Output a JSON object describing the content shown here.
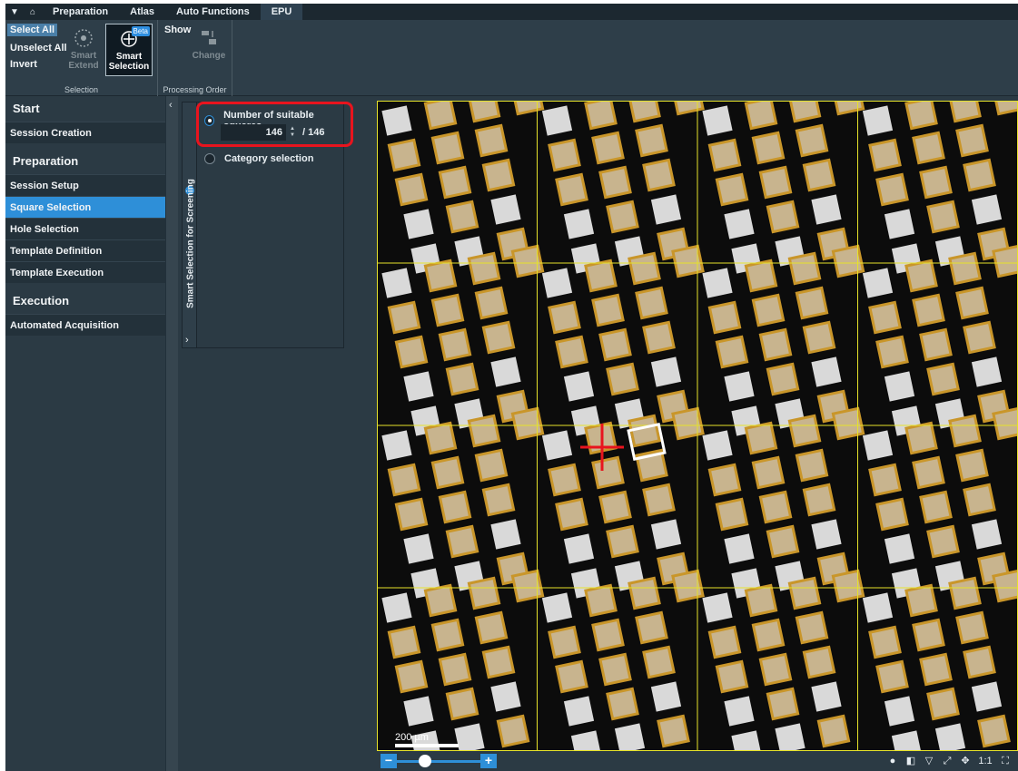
{
  "menubar": {
    "dropdown_icon": "caret-down-icon",
    "home_icon": "home-icon",
    "tabs": [
      {
        "label": "Preparation"
      },
      {
        "label": "Atlas"
      },
      {
        "label": "Auto Functions"
      },
      {
        "label": "EPU"
      }
    ],
    "active_tab": "EPU"
  },
  "ribbon": {
    "selection_group": {
      "label": "Selection",
      "select_all": "Select All",
      "unselect_all": "Unselect All",
      "invert": "Invert",
      "smart_extend": "Smart Extend",
      "smart_selection": "Smart Selection",
      "beta": "Beta"
    },
    "processing_group": {
      "label": "Processing Order",
      "show": "Show",
      "change": "Change"
    }
  },
  "workflow": {
    "sections": [
      {
        "header": "Start",
        "items": [
          "Session Creation"
        ]
      },
      {
        "header": "Preparation",
        "items": [
          "Session Setup",
          "Square Selection",
          "Hole Selection",
          "Template Definition",
          "Template Execution"
        ]
      },
      {
        "header": "Execution",
        "items": [
          "Automated Acquisition"
        ]
      }
    ],
    "active_item": "Square Selection"
  },
  "smart_panel": {
    "tab_label": "Smart Selection for Screening",
    "option_count": "Number of suitable squares",
    "count_value": "146",
    "count_total": "/ 146",
    "option_category": "Category selection"
  },
  "viewer": {
    "scale_label": "200 µm",
    "colors": {
      "selected_square": "#c9962a",
      "grid_line": "#e6e22a",
      "crosshair": "#e8141e"
    }
  },
  "toolbar": {
    "zoom_minus": "−",
    "zoom_plus": "+",
    "zoom_level": 0.4,
    "one_to_one": "1:1",
    "tools": [
      "color-palette-icon",
      "layers-icon",
      "filter-icon",
      "fit-icon",
      "pan-icon",
      "one-to-one-icon",
      "fullscreen-icon"
    ]
  }
}
